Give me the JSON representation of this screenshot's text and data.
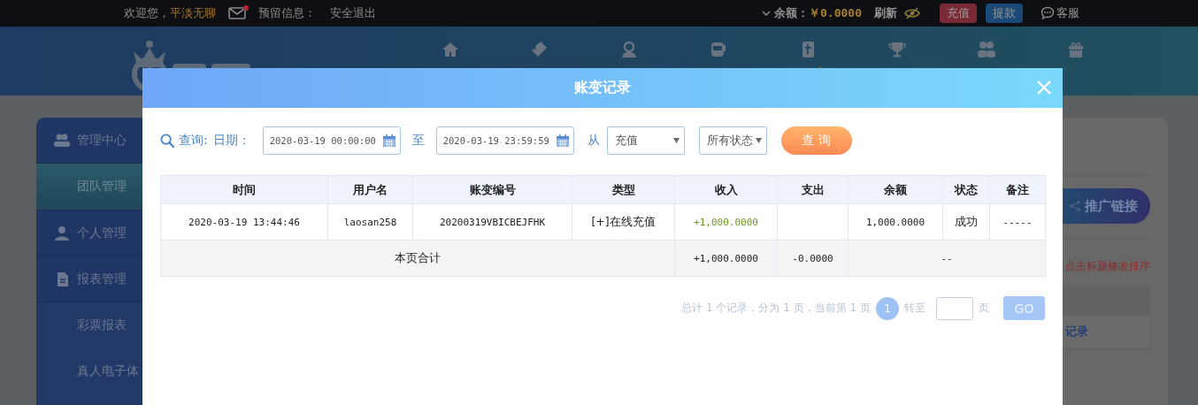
{
  "topbar": {
    "welcome": "欢迎您，",
    "username": "平淡无聊",
    "has_unread_mail": true,
    "reserved_label": "预留信息：",
    "logout": "安全退出",
    "balance_label": "余额：",
    "balance": "￥0.0000",
    "refresh": "刷新",
    "deposit": "充值",
    "withdraw": "提款",
    "service": "客服"
  },
  "sidebar": {
    "items": [
      {
        "label": "管理中心",
        "kind": "group",
        "selected": false
      },
      {
        "label": "团队管理",
        "kind": "sub",
        "selected": true
      },
      {
        "label": "个人管理",
        "kind": "group",
        "selected": false
      },
      {
        "label": "报表管理",
        "kind": "group",
        "selected": false
      },
      {
        "label": "彩票报表",
        "kind": "sub",
        "selected": false
      },
      {
        "label": "真人电子体",
        "kind": "sub",
        "selected": false
      }
    ]
  },
  "side_panel": {
    "promo_link": "推广链接",
    "sort_hint": "点击标题修改排序",
    "link": "记录"
  },
  "dialog": {
    "title": "账变记录",
    "query_label": "查询:",
    "date_label": "日期：",
    "start_date": "2020-03-19 00:00:00",
    "to": "至",
    "end_date": "2020-03-19 23:59:59",
    "from": "从",
    "type_select": "充值",
    "status_select": "所有状态",
    "search_button": "查 询",
    "table": {
      "columns": [
        "时间",
        "用户名",
        "账变编号",
        "类型",
        "收入",
        "支出",
        "余额",
        "状态",
        "备注"
      ],
      "rows": [
        {
          "cells": [
            "2020-03-19 13:44:46",
            "laosan258",
            "20200319VBICBEJFHK",
            "[+]在线充值",
            "+1,000.0000",
            "",
            "1,000.0000",
            "成功",
            "-----"
          ]
        }
      ],
      "total": {
        "label": "本页合计",
        "income": "+1,000.0000",
        "expense": "-0.0000",
        "rest": "--"
      }
    },
    "pagination": {
      "summary": "总计 1 个记录，分为 1 页，当前第 1 页",
      "pages": [
        {
          "label": "1",
          "selected": true
        }
      ],
      "goto_label": "转至",
      "page_unit": "页",
      "go_button": "GO"
    }
  }
}
